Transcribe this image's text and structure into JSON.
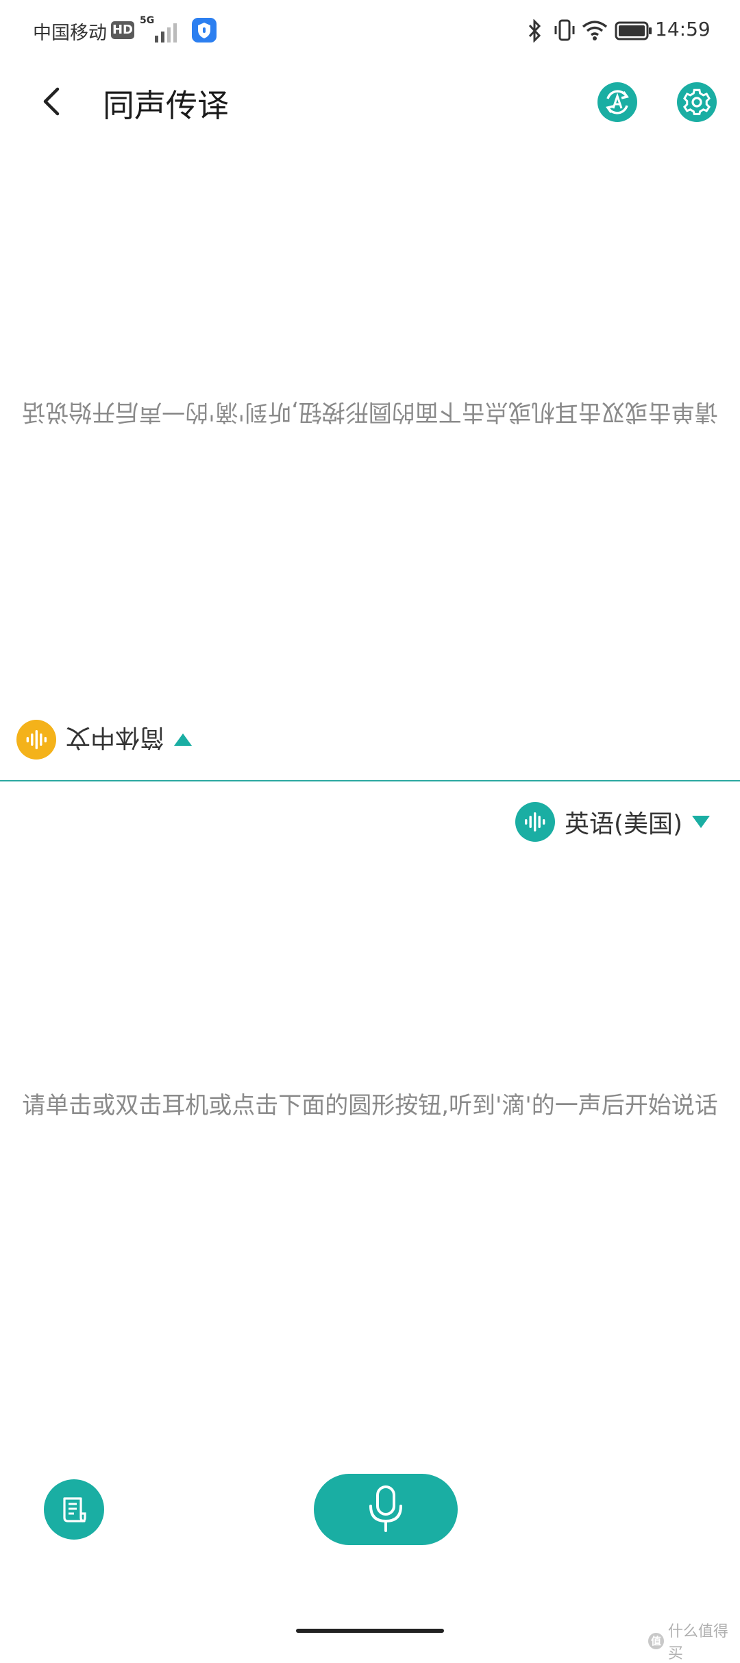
{
  "status_bar": {
    "carrier": "中国移动",
    "hd": "HD",
    "network": "5G",
    "time": "14:59"
  },
  "header": {
    "title": "同声传译",
    "translate_icon": "translate-refresh-icon",
    "settings_icon": "gear-icon"
  },
  "upper_panel": {
    "language": "简体中文",
    "hint": "请单击或双击耳机或点击下面的圆形按钮,听到'滴'的一声后开始说话",
    "voice_color": "#f4b21a"
  },
  "lower_panel": {
    "language": "英语(美国)",
    "hint": "请单击或双击耳机或点击下面的圆形按钮,听到'滴'的一声后开始说话",
    "voice_color": "#1aaea3"
  },
  "controls": {
    "history_icon": "notes-icon",
    "mic_icon": "microphone-icon"
  },
  "colors": {
    "accent": "#1aaea3",
    "upper_accent": "#f4b21a",
    "hint_text": "#8a8a8a"
  },
  "watermark": {
    "badge": "值",
    "text": "什么值得买"
  }
}
